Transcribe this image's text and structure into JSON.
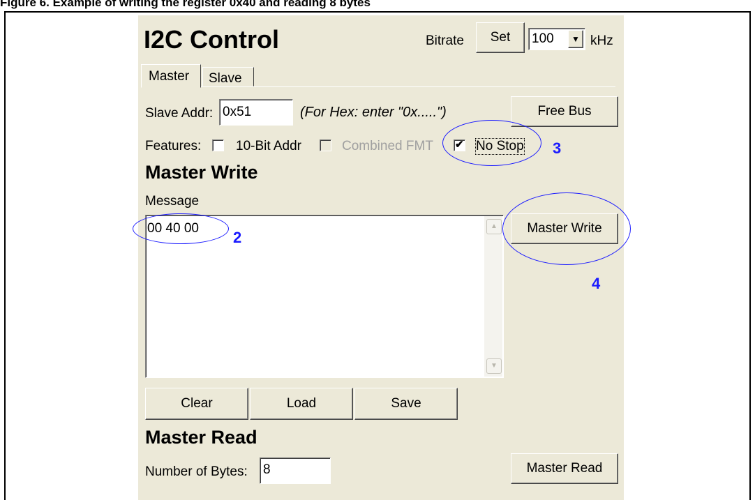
{
  "caption": "Figure 6.  Example of writing the register 0x40 and reading 8 bytes",
  "panel": {
    "title": "I2C Control",
    "bitrate_label": "Bitrate",
    "set_button": "Set",
    "bitrate_value": "100",
    "unit": "kHz"
  },
  "tabs": [
    {
      "label": "Master",
      "active": true
    },
    {
      "label": "Slave",
      "active": false
    }
  ],
  "slave_addr": {
    "label": "Slave Addr:",
    "value": "0x51",
    "hint": "(For Hex: enter \"0x.....\")"
  },
  "free_bus_button": "Free Bus",
  "features": {
    "label": "Features:",
    "ten_bit": {
      "label": "10-Bit Addr",
      "checked": false
    },
    "combined": {
      "label": "Combined FMT",
      "checked": false,
      "disabled": true
    },
    "no_stop": {
      "label": "No Stop",
      "checked": true
    }
  },
  "master_write": {
    "heading": "Master Write",
    "message_label": "Message",
    "message_value": "00 40 00",
    "button": "Master Write",
    "clear": "Clear",
    "load": "Load",
    "save": "Save"
  },
  "master_read": {
    "heading": "Master Read",
    "bytes_label": "Number of Bytes:",
    "bytes_value": "8",
    "button": "Master Read"
  },
  "annotations": {
    "a2": "2",
    "a3": "3",
    "a4": "4",
    "color": "#1a1aff"
  }
}
